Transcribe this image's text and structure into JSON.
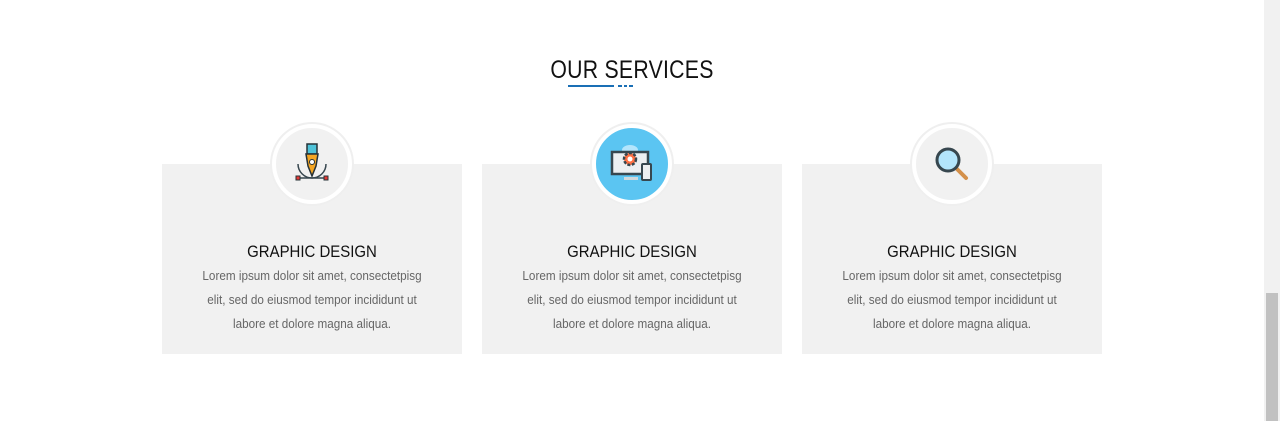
{
  "section": {
    "title": "OUR SERVICES",
    "accent": "#1a6fb5"
  },
  "services": [
    {
      "icon": "pen-tool-icon",
      "title": "GRAPHIC DESIGN",
      "text": "Lorem ipsum dolor sit amet, consectetpisg elit, sed do eiusmod tempor incididunt ut labore et dolore magna aliqua.",
      "active": false
    },
    {
      "icon": "monitor-gear-icon",
      "title": "GRAPHIC DESIGN",
      "text": "Lorem ipsum dolor sit amet, consectetpisg elit, sed do eiusmod tempor incididunt ut labore et dolore magna aliqua.",
      "active": true,
      "color": "#5bc5f2"
    },
    {
      "icon": "magnifier-icon",
      "title": "GRAPHIC DESIGN",
      "text": "Lorem ipsum dolor sit amet, consectetpisg elit, sed do eiusmod tempor incididunt ut labore et dolore magna aliqua.",
      "active": false
    }
  ]
}
